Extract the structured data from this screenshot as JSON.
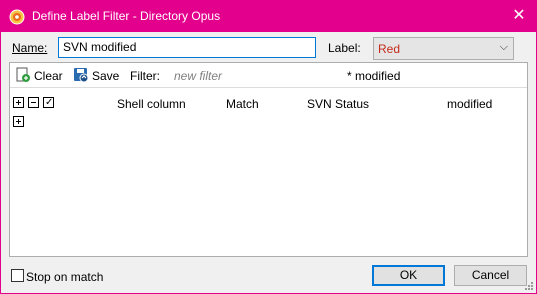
{
  "window": {
    "title": "Define Label Filter - Directory Opus",
    "close_glyph": "✕"
  },
  "form": {
    "name_label": "Name:",
    "name_value": "SVN modified",
    "label_label": "Label:",
    "label_value": "Red",
    "label_value_color": "#c42b1c"
  },
  "toolbar": {
    "clear_label": "Clear",
    "save_label": "Save",
    "filter_label": "Filter:",
    "filter_placeholder": "new filter",
    "filter_result": "* modified"
  },
  "columns": [
    "Shell column",
    "Match",
    "SVN Status",
    "modified"
  ],
  "footer": {
    "stop_on_match_label": "Stop on match",
    "stop_on_match_checked": false,
    "ok_label": "OK",
    "cancel_label": "Cancel"
  },
  "colors": {
    "accent": "#e3008c",
    "focus": "#0078d7"
  },
  "icons": {
    "app": "directory-opus-icon",
    "clear": "clear-filter-icon",
    "save": "save-icon",
    "expand": "plus-box-icon",
    "collapse": "minus-box-icon",
    "check": "check-box-icon"
  }
}
